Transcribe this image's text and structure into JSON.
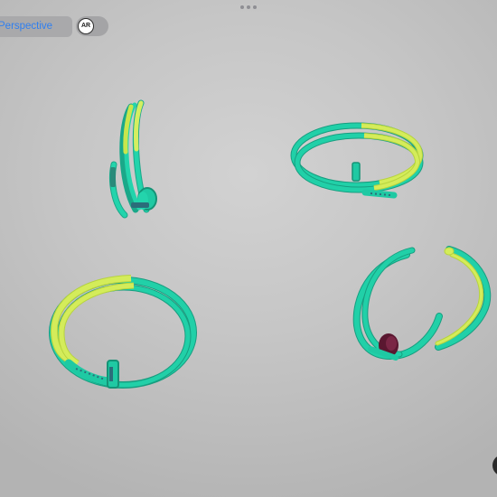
{
  "toolbar": {
    "view_mode_label": "Perspective",
    "ar_label": "AR"
  },
  "colors": {
    "background": "#c8c8c8",
    "metal_teal": "#1fc9a3",
    "metal_lime": "#c9e64c",
    "stone": "#5a1730",
    "accent_blue": "#2f7ff0"
  },
  "icons": {
    "grabber": "ellipsis-icon",
    "ar": "ar-icon"
  }
}
